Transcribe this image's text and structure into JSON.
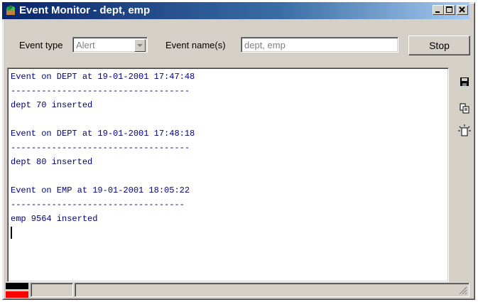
{
  "window": {
    "title": "Event Monitor - dept, emp"
  },
  "toolbar": {
    "event_type_label": "Event type",
    "event_type_value": "Alert",
    "event_name_label": "Event name(s)",
    "event_name_value": "dept, emp",
    "stop_label": "Stop"
  },
  "output": {
    "lines": [
      "Event on DEPT at 19-01-2001 17:47:48",
      "-----------------------------------",
      "dept 70 inserted",
      "",
      "Event on DEPT at 19-01-2001 17:48:18",
      "-----------------------------------",
      "dept 80 inserted",
      "",
      "Event on EMP at 19-01-2001 18:05:22",
      "----------------------------------",
      "emp 9564 inserted"
    ]
  },
  "side_icons": [
    "save-icon",
    "copy-icon",
    "clear-icon"
  ],
  "colors": {
    "title_start": "#0a246a",
    "title_end": "#a6caf0",
    "text": "#000080",
    "flag_red": "#ff0000"
  }
}
